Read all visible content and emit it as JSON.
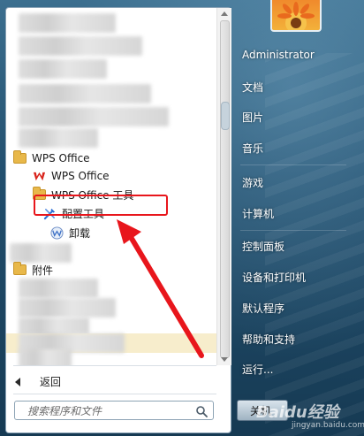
{
  "left_pane": {
    "tree": [
      {
        "id": "wps-office-folder",
        "label": "WPS Office"
      },
      {
        "id": "wps-office-app",
        "label": "WPS Office"
      },
      {
        "id": "wps-office-tools-folder",
        "label": "WPS Office 工具"
      },
      {
        "id": "config-tool",
        "label": "配置工具"
      },
      {
        "id": "uninstall",
        "label": "卸载"
      },
      {
        "id": "accessories-folder",
        "label": "附件"
      }
    ],
    "back_label": "返回",
    "search_placeholder": "搜索程序和文件"
  },
  "right_pane": {
    "user": "Administrator",
    "items": [
      "文档",
      "图片",
      "音乐",
      "游戏",
      "计算机",
      "控制面板",
      "设备和打印机",
      "默认程序",
      "帮助和支持",
      "运行..."
    ],
    "shutdown_label": "关机"
  },
  "watermark": {
    "main": "Baidu经验",
    "sub": "jingyan.baidu.com"
  },
  "colors": {
    "highlight_box": "#e8161c",
    "wps_red": "#d9241c",
    "folder": "#e8b84a",
    "selection": "#f7edcc"
  }
}
